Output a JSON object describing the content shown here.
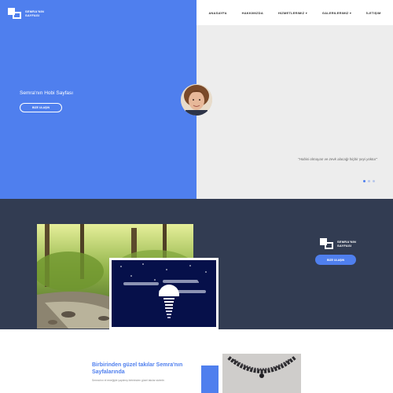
{
  "brand": {
    "logo_text": "SEMRA'NIN SAYFASI"
  },
  "nav": {
    "items": [
      "Anasayfa",
      "Hakkımızda",
      "Hizmetlerimiz",
      "Galerilerimiz",
      "İletişim"
    ]
  },
  "hero": {
    "title": "Semra'nın Hobi Sayfası",
    "button_label": "Bize Ulaşın",
    "quote": "\"Hobisi olmayan ve zevk alacağı hiçbir şeyi yoktur\"",
    "slider_count": 3,
    "slider_active": 1
  },
  "band": {
    "logo_text": "SEMRA'NIN SAYFASI",
    "button_label": "Bize Ulaşın"
  },
  "lower": {
    "title": "Birbirinden güzel takılar Semra'nın Sayfalarında",
    "text": "Semra'nın el emeğiyle yapılmış birbirinden güzel takılar sizlerle."
  },
  "colors": {
    "accent": "#4f7fee",
    "dark_band": "#323c52",
    "light_panel": "#ededed"
  }
}
